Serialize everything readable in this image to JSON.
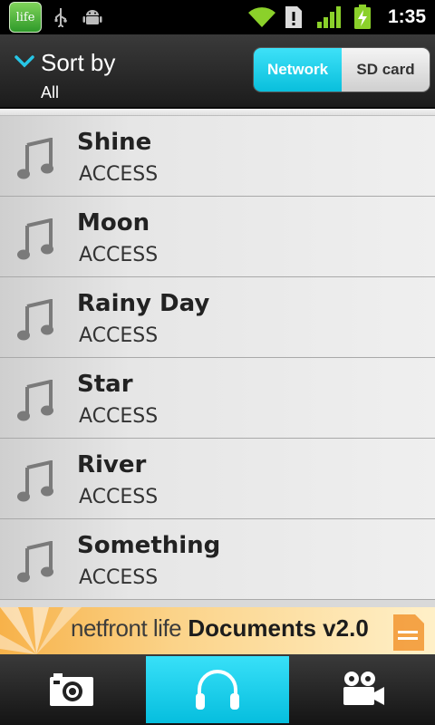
{
  "status_bar": {
    "app_badge": "life",
    "time": "1:35",
    "icons": [
      "netfront-life-app-icon",
      "usb-icon",
      "android-debug-icon",
      "wifi-icon",
      "sim-alert-icon",
      "signal-icon",
      "battery-charging-icon"
    ]
  },
  "header": {
    "sort_title": "Sort by",
    "sort_value": "All",
    "segments": [
      {
        "label": "Network",
        "active": true
      },
      {
        "label": "SD card",
        "active": false
      }
    ]
  },
  "tracks": [
    {
      "title": "Shine",
      "artist": "ACCESS"
    },
    {
      "title": "Moon",
      "artist": "ACCESS"
    },
    {
      "title": "Rainy Day",
      "artist": "ACCESS"
    },
    {
      "title": "Star",
      "artist": "ACCESS"
    },
    {
      "title": "River",
      "artist": "ACCESS"
    },
    {
      "title": "Something",
      "artist": "ACCESS"
    }
  ],
  "banner": {
    "brand": "netfront life",
    "product": "Documents v2.0"
  },
  "bottom_tabs": [
    {
      "name": "camera-icon",
      "active": false
    },
    {
      "name": "headphones-icon",
      "active": true
    },
    {
      "name": "video-camera-icon",
      "active": false
    }
  ],
  "colors": {
    "accent": "#09bfdc",
    "header_bg": "#2a2a2a",
    "list_bg": "#e6e6e6",
    "banner_orange": "#f7b24a"
  }
}
